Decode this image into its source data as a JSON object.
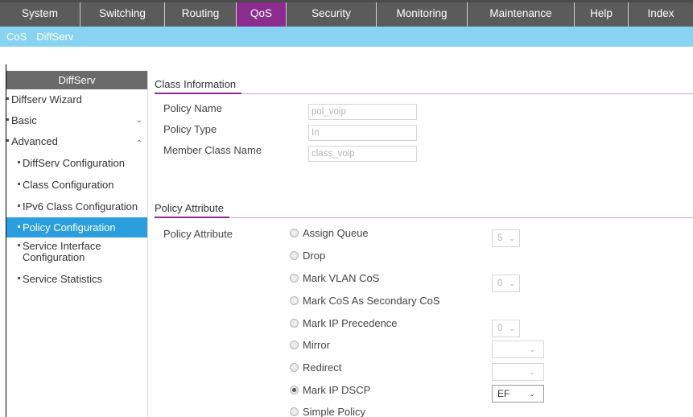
{
  "topnav": {
    "tabs": [
      {
        "label": "System",
        "width": 100,
        "active": false
      },
      {
        "label": "Switching",
        "width": 105,
        "active": false
      },
      {
        "label": "Routing",
        "width": 89,
        "active": false
      },
      {
        "label": "QoS",
        "width": 62,
        "active": true
      },
      {
        "label": "Security",
        "width": 112,
        "active": false
      },
      {
        "label": "Monitoring",
        "width": 113,
        "active": false
      },
      {
        "label": "Maintenance",
        "width": 133,
        "active": false
      },
      {
        "label": "Help",
        "width": 67,
        "active": false
      },
      {
        "label": "Index",
        "width": 80,
        "active": false
      }
    ]
  },
  "subnav": {
    "items": [
      "CoS",
      "DiffServ"
    ]
  },
  "sidebar": {
    "header": "DiffServ",
    "items": [
      {
        "label": "Diffserv Wizard"
      },
      {
        "label": "Basic",
        "chevron": "⌄"
      },
      {
        "label": "Advanced",
        "chevron": "⌃"
      },
      {
        "label": "DiffServ Configuration"
      },
      {
        "label": "Class Configuration"
      },
      {
        "label": "IPv6 Class Configuration"
      },
      {
        "label": "Policy Configuration"
      },
      {
        "label": "Service Interface Configuration",
        "line1": "Service Interface",
        "line2": "Configuration"
      },
      {
        "label": "Service Statistics"
      }
    ]
  },
  "class_info": {
    "title": "Class Information",
    "policy_name_label": "Policy Name",
    "policy_name_value": "pol_voip",
    "policy_type_label": "Policy Type",
    "policy_type_value": "In",
    "member_class_label": "Member Class Name",
    "member_class_value": "class_voip"
  },
  "policy_attr": {
    "title": "Policy Attribute",
    "label": "Policy Attribute",
    "options": [
      {
        "label": "Assign Queue",
        "checked": false,
        "select": "5"
      },
      {
        "label": "Drop",
        "checked": false
      },
      {
        "label": "Mark VLAN CoS",
        "checked": false,
        "select": "0"
      },
      {
        "label": "Mark CoS As Secondary CoS",
        "checked": false
      },
      {
        "label": "Mark IP Precedence",
        "checked": false,
        "select": "0"
      },
      {
        "label": "Mirror",
        "checked": false,
        "select": ""
      },
      {
        "label": "Redirect",
        "checked": false,
        "select": ""
      },
      {
        "label": "Mark IP DSCP",
        "checked": true,
        "select": "EF"
      },
      {
        "label": "Simple Policy",
        "checked": false
      }
    ]
  }
}
